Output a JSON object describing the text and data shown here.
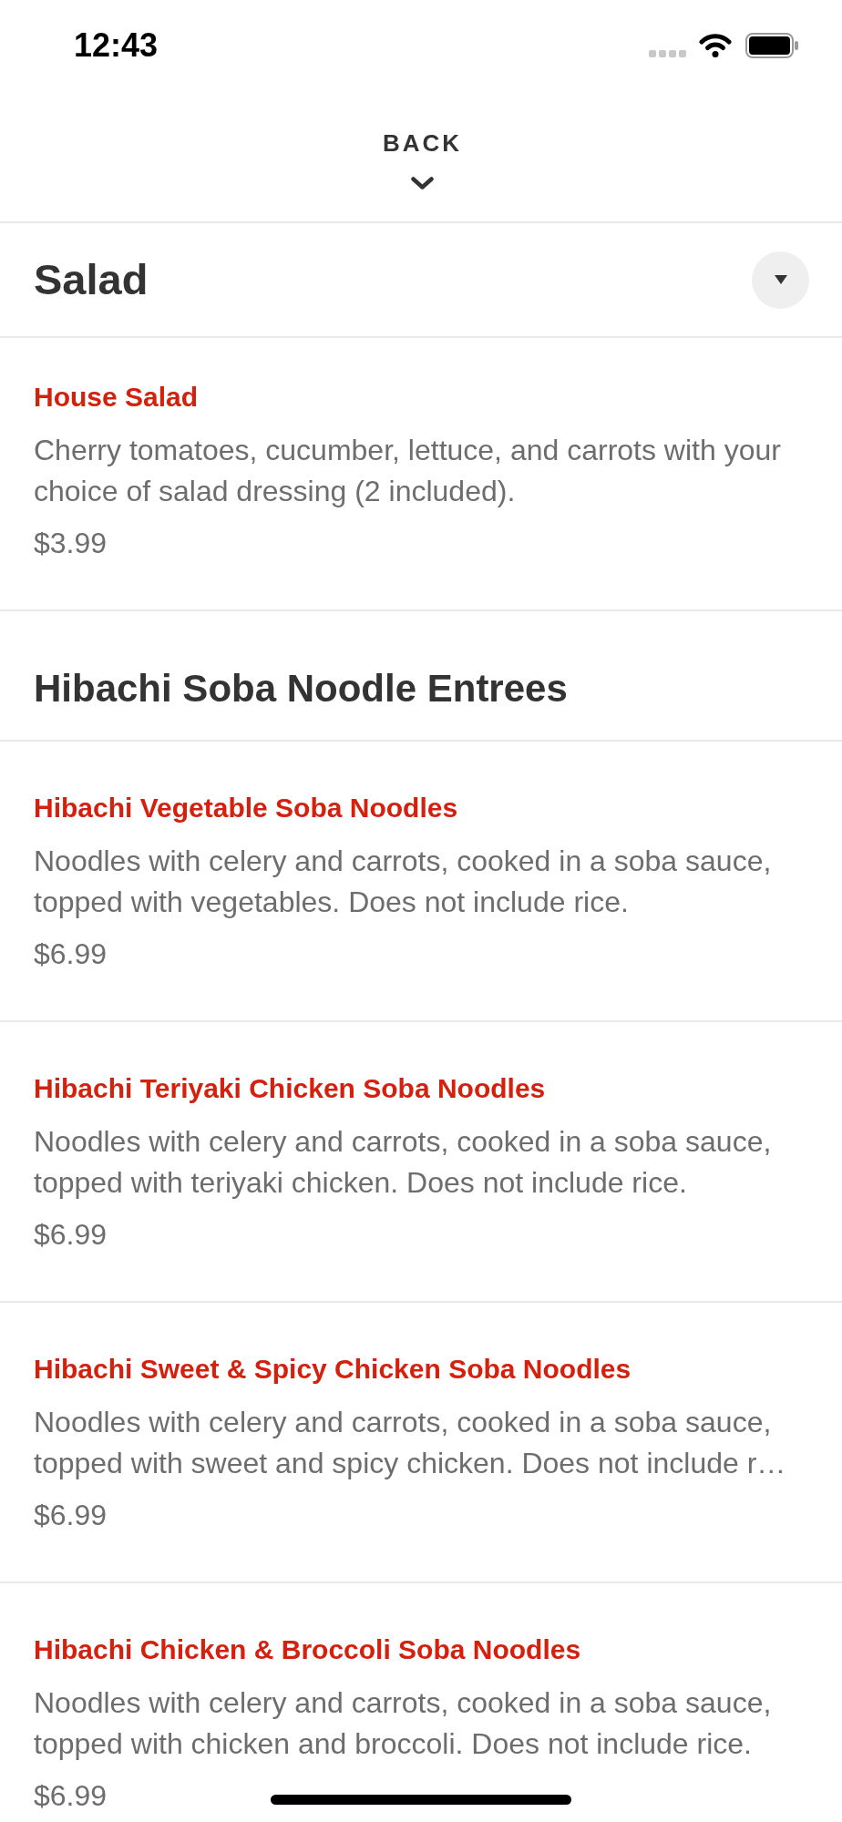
{
  "status_bar": {
    "time": "12:43"
  },
  "nav": {
    "back_label": "BACK"
  },
  "sections": [
    {
      "kind": "collapsible",
      "title": "Salad",
      "items": [
        {
          "name": "House Salad",
          "description": "Cherry tomatoes, cucumber, lettuce, and carrots with your choice of salad dressing (2 included).",
          "price": "$3.99"
        }
      ]
    },
    {
      "kind": "plain",
      "title": "Hibachi Soba Noodle Entrees",
      "items": [
        {
          "name": "Hibachi Vegetable Soba Noodles",
          "description": "Noodles with celery and carrots, cooked in a soba sauce, topped with vegetables. Does not include rice.",
          "price": "$6.99"
        },
        {
          "name": "Hibachi Teriyaki Chicken Soba Noodles",
          "description": "Noodles with celery and carrots, cooked in a soba sauce, topped with teriyaki chicken. Does not include rice.",
          "price": "$6.99"
        },
        {
          "name": "Hibachi Sweet & Spicy Chicken Soba Noodles",
          "description": "Noodles with celery and carrots, cooked in a soba sauce, topped with sweet and spicy chicken. Does not include r…",
          "price": "$6.99"
        },
        {
          "name": "Hibachi Chicken & Broccoli Soba Noodles",
          "description": "Noodles with celery and carrots, cooked in a soba sauce, topped with chicken and broccoli. Does not include rice.",
          "price": "$6.99"
        }
      ]
    }
  ]
}
